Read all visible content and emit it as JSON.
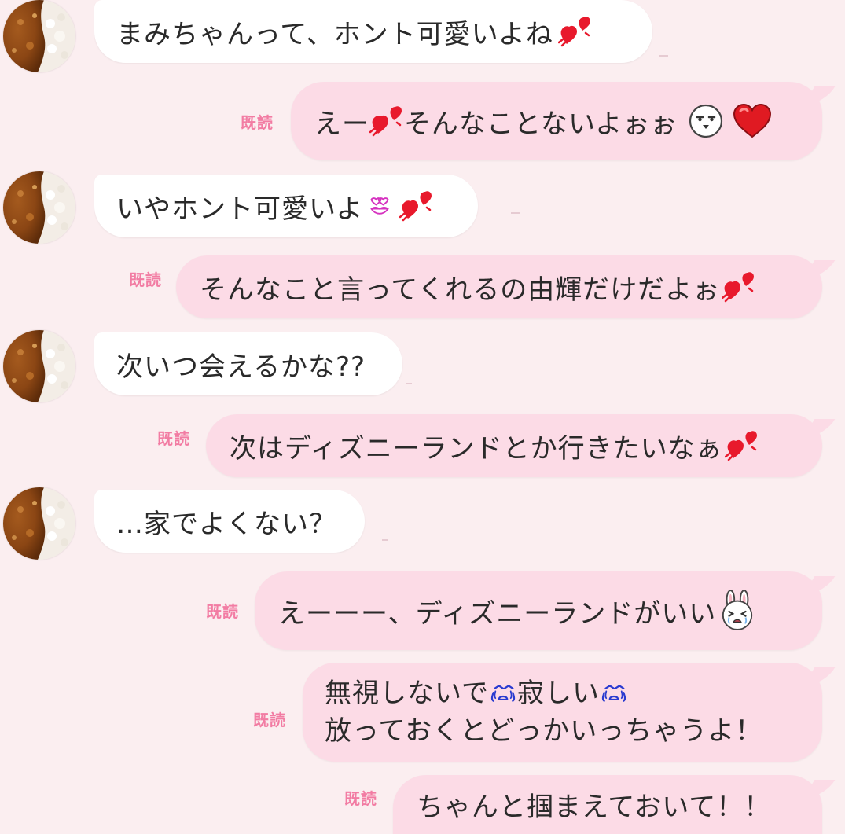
{
  "chat": {
    "read_label": "既読",
    "messages": [
      {
        "from": "other",
        "text": "まみちゃんって、ホント可愛いよね",
        "emoji": [
          "heart-pair-icon"
        ]
      },
      {
        "from": "self",
        "text": "えー",
        "text2": "そんなことないよぉぉ",
        "read": "既読",
        "emoji": [
          "heart-pair-icon",
          "face-icon",
          "red-heart-icon"
        ]
      },
      {
        "from": "other",
        "text": "いやホント可愛いよ",
        "emoji": [
          "kiss-lips-icon",
          "heart-pair-icon"
        ]
      },
      {
        "from": "self",
        "text": "そんなこと言ってくれるの由輝だけだよぉ",
        "read": "既読",
        "emoji": [
          "heart-pair-icon"
        ]
      },
      {
        "from": "other",
        "text": "次いつ会えるかな??"
      },
      {
        "from": "self",
        "text": "次はディズニーランドとか行きたいなぁ",
        "read": "既読",
        "emoji": [
          "heart-pair-icon"
        ]
      },
      {
        "from": "other",
        "text": "…家でよくない？"
      },
      {
        "from": "self",
        "text": "えーーー、ディズニーランドがいい",
        "read": "既読",
        "emoji": [
          "crying-bunny-icon"
        ]
      },
      {
        "from": "self",
        "lines": [
          "無視しないで",
          "寂しい",
          "放っておくとどっかいっちゃうよ！"
        ],
        "read": "既読",
        "emoji": [
          "crying-face-icon",
          "crying-face-icon"
        ]
      },
      {
        "from": "self",
        "text": "ちゃんと掴まえておいて！！",
        "read": "既読"
      }
    ]
  },
  "colors": {
    "background": "#fbeef0",
    "other_bubble": "#ffffff",
    "self_bubble": "#fcdbe6",
    "read_label": "#f27ca3",
    "text": "#2a2a2a",
    "heart": "#e8192c"
  }
}
